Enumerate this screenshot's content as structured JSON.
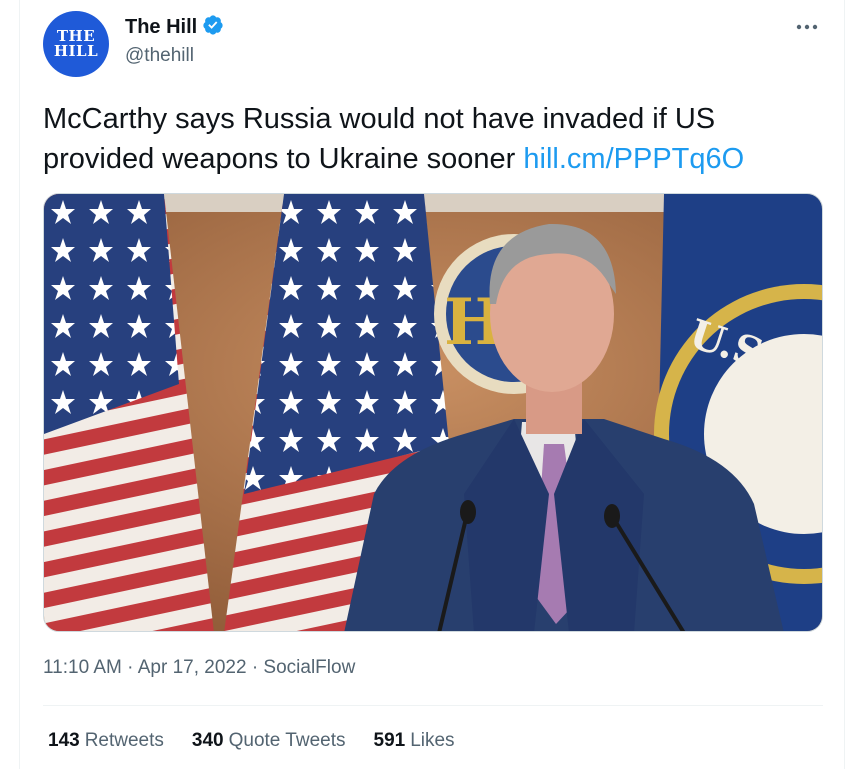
{
  "author": {
    "avatar_line1": "THE",
    "avatar_line2": "HILL",
    "display_name": "The Hill",
    "handle": "@thehill",
    "verified": true
  },
  "tweet": {
    "text": "McCarthy says Russia would not have invaded if US provided weapons to Ukraine sooner",
    "link_text": "hill.cm/PPPTq6O"
  },
  "meta": {
    "time": "11:10 AM",
    "separator": "·",
    "date": "Apr 17, 2022",
    "source": "SocialFlow"
  },
  "stats": {
    "retweets_count": "143",
    "retweets_label": "Retweets",
    "quotes_count": "340",
    "quotes_label": "Quote Tweets",
    "likes_count": "591",
    "likes_label": "Likes"
  },
  "colors": {
    "accent": "#1d9bf0",
    "text_primary": "#0f1419",
    "text_secondary": "#536471",
    "avatar_bg": "#1f5ad8"
  },
  "icons": {
    "verified": "verified-badge-icon",
    "more": "more-options-icon"
  },
  "photo_text": {
    "seal_partial": "U.S. HO",
    "backdrop_partial": "H"
  }
}
